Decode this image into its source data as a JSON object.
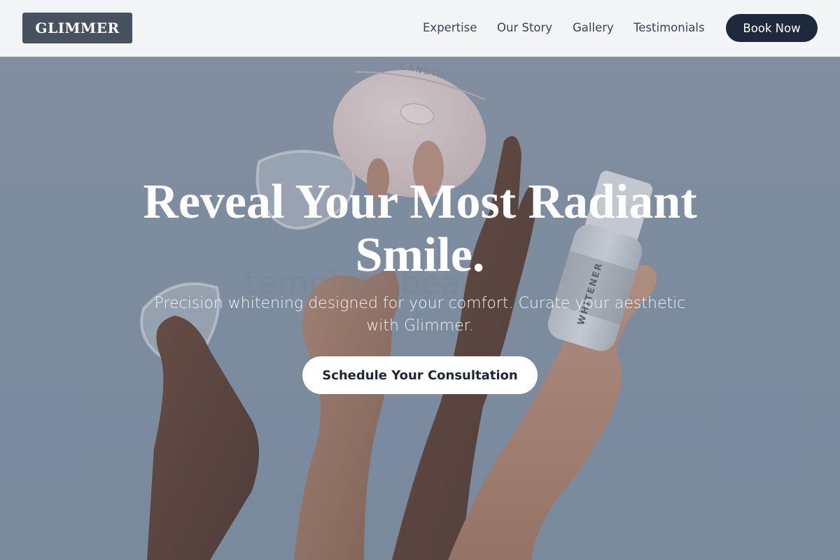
{
  "header": {
    "logo_text": "GLIMMER",
    "nav": [
      "Expertise",
      "Our Story",
      "Gallery",
      "Testimonials"
    ],
    "book_label": "Book Now"
  },
  "hero": {
    "headline_line1": "Reveal Your Most Radiant",
    "headline_line2": "Smile.",
    "subtitle_line1": "Precision whitening designed for your comfort. Curate your aesthetic",
    "subtitle_line2": "with Glimmer.",
    "cta_label": "Schedule Your Consultation",
    "watermark": "template.bea",
    "case_text": "CANDID",
    "bottle_text": "WHITENER"
  },
  "colors": {
    "header_bg": "#f3f4f6",
    "logo_bg": "#475261",
    "accent": "#1d2a3d",
    "hero_bg": "#8a9aab"
  }
}
